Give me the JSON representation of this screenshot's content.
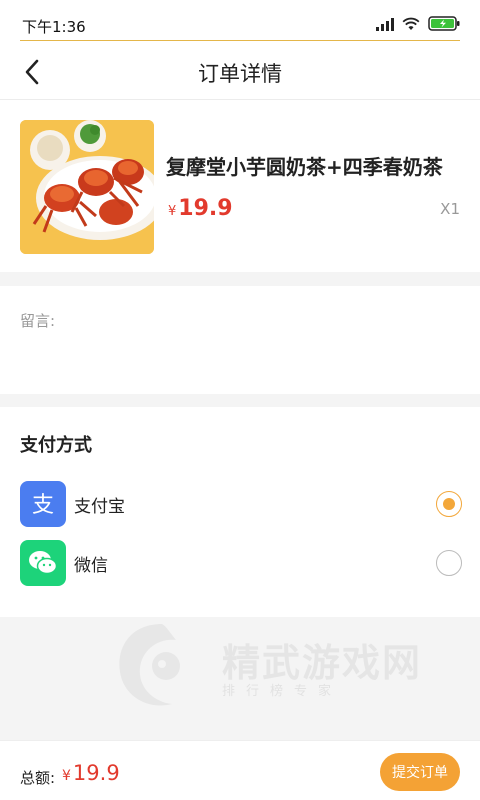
{
  "status_bar": {
    "time": "下午1:36"
  },
  "nav": {
    "title": "订单详情",
    "back_icon": "chevron-left-icon"
  },
  "product": {
    "name": "复摩堂小芋圆奶茶+四季春奶茶",
    "currency": "¥",
    "price": "19.9",
    "quantity": "X1",
    "image": "crab-dish-photo"
  },
  "remark": {
    "label": "留言:"
  },
  "payment": {
    "heading": "支付方式",
    "options": [
      {
        "label": "支付宝",
        "icon": "alipay-icon",
        "color": "#4b7df0",
        "selected": true
      },
      {
        "label": "微信",
        "icon": "wechat-icon",
        "color": "#1dd37a",
        "selected": false
      }
    ]
  },
  "watermark": {
    "title": "精武游戏网",
    "subtitle": "排行榜专家"
  },
  "footer": {
    "total_label": "总额:",
    "currency": "¥",
    "total": "19.9",
    "submit_label": "提交订单"
  },
  "colors": {
    "accent": "#f4a235",
    "price": "#e23a2d"
  }
}
